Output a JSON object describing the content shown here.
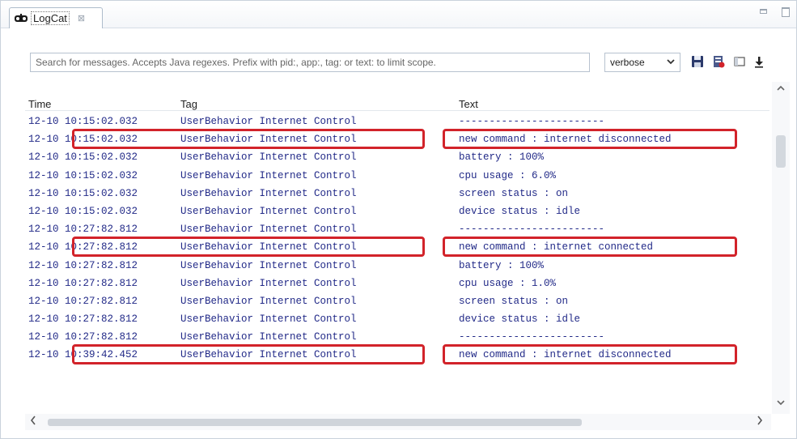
{
  "window": {
    "tab_label": "LogCat",
    "tab_close_glyph": "⊠",
    "icons": [
      "logcat-icon",
      "close-icon",
      "minimize-icon",
      "maximize-icon"
    ]
  },
  "toolbar": {
    "search_placeholder": "Search for messages. Accepts Java regexes. Prefix with pid:, app:, tag: or text: to limit scope.",
    "level_value": "verbose",
    "icons": [
      "save-icon",
      "clear-log-icon",
      "toggle-panel-icon",
      "scroll-lock-icon"
    ]
  },
  "table": {
    "columns": {
      "time": "Time",
      "tag": "Tag",
      "text": "Text"
    },
    "rows": [
      {
        "time": "12-10 10:15:02.032",
        "tag": "UserBehavior Internet Control",
        "text": "------------------------",
        "highlighted": false
      },
      {
        "time": "12-10 10:15:02.032",
        "tag": "UserBehavior Internet Control",
        "text": "new command : internet disconnected",
        "highlighted": true
      },
      {
        "time": "12-10 10:15:02.032",
        "tag": "UserBehavior Internet Control",
        "text": "battery : 100%",
        "highlighted": false
      },
      {
        "time": "12-10 10:15:02.032",
        "tag": "UserBehavior Internet Control",
        "text": "cpu usage : 6.0%",
        "highlighted": false
      },
      {
        "time": "12-10 10:15:02.032",
        "tag": "UserBehavior Internet Control",
        "text": "screen status : on",
        "highlighted": false
      },
      {
        "time": "12-10 10:15:02.032",
        "tag": "UserBehavior Internet Control",
        "text": "device status : idle",
        "highlighted": false
      },
      {
        "time": "12-10 10:27:82.812",
        "tag": "UserBehavior Internet Control",
        "text": "------------------------",
        "highlighted": false
      },
      {
        "time": "12-10 10:27:82.812",
        "tag": "UserBehavior Internet Control",
        "text": "new command : internet connected",
        "highlighted": true
      },
      {
        "time": "12-10 10:27:82.812",
        "tag": "UserBehavior Internet Control",
        "text": "battery : 100%",
        "highlighted": false
      },
      {
        "time": "12-10 10:27:82.812",
        "tag": "UserBehavior Internet Control",
        "text": "cpu usage : 1.0%",
        "highlighted": false
      },
      {
        "time": "12-10 10:27:82.812",
        "tag": "UserBehavior Internet Control",
        "text": "screen status : on",
        "highlighted": false
      },
      {
        "time": "12-10 10:27:82.812",
        "tag": "UserBehavior Internet Control",
        "text": "device status : idle",
        "highlighted": false
      },
      {
        "time": "12-10 10:27:82.812",
        "tag": "UserBehavior Internet Control",
        "text": "------------------------",
        "highlighted": false
      },
      {
        "time": "12-10 10:39:42.452",
        "tag": "UserBehavior Internet Control",
        "text": "new command : internet disconnected",
        "highlighted": true
      }
    ]
  },
  "colors": {
    "log_text": "#222a88",
    "highlight_border": "#d2232a",
    "header_text": "#222222"
  },
  "scrollbars": {
    "left_arrow": "<",
    "right_arrow": ">",
    "up_arrow": "^",
    "down_arrow": "v"
  }
}
